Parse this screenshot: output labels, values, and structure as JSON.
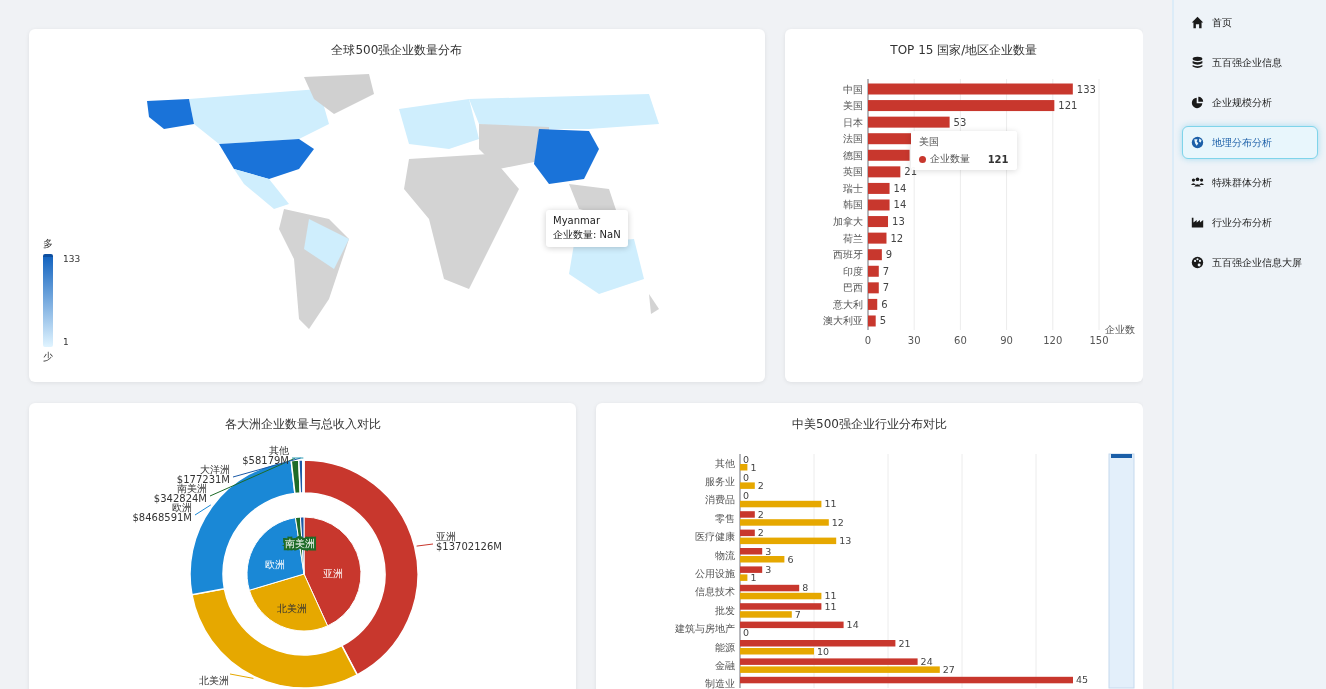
{
  "sidebar": {
    "items": [
      {
        "label": "首页",
        "selected": false
      },
      {
        "label": "五百强企业信息",
        "selected": false
      },
      {
        "label": "企业规模分析",
        "selected": false
      },
      {
        "label": "地理分布分析",
        "selected": true
      },
      {
        "label": "特殊群体分析",
        "selected": false
      },
      {
        "label": "行业分布分析",
        "selected": false
      },
      {
        "label": "五百强企业信息大屏",
        "selected": false
      }
    ]
  },
  "world_map": {
    "title": "全球500强企业数量分布",
    "visual_map": {
      "high_label": "多",
      "max": "133",
      "min": "1",
      "low_label": "少"
    },
    "tooltip": {
      "name": "Myanmar",
      "line": "企业数量: NaN"
    }
  },
  "top_countries": {
    "title": "TOP 15 国家/地区企业数量",
    "chart_data": {
      "type": "bar",
      "orientation": "horizontal",
      "xlabel": "企业数",
      "grid": true,
      "categories": [
        "中国",
        "美国",
        "日本",
        "法国",
        "德国",
        "英国",
        "瑞士",
        "韩国",
        "加拿大",
        "荷兰",
        "西班牙",
        "印度",
        "巴西",
        "意大利",
        "澳大利亚"
      ],
      "series": [
        {
          "color": "#c8372d",
          "values": [
            133,
            121,
            53,
            28,
            27,
            21,
            14,
            14,
            13,
            12,
            9,
            7,
            7,
            6,
            5
          ]
        }
      ],
      "value_labels": [
        "133",
        "121",
        "53",
        null,
        null,
        "21",
        "14",
        "14",
        "13",
        "12",
        "9",
        "7",
        "7",
        "6",
        "5"
      ],
      "xlim": [
        0,
        150
      ],
      "xticks": [
        0,
        30,
        60,
        90,
        120,
        150
      ]
    },
    "tooltip": {
      "category": "美国",
      "label": "企业数量",
      "value": "121"
    }
  },
  "continents": {
    "title": "各大洲企业数量与总收入对比",
    "chart_data": {
      "type": "donut",
      "categories": [
        "亚洲",
        "北美洲",
        "欧洲",
        "南美洲",
        "大洋洲",
        "其他"
      ],
      "colors": [
        "#c8372d",
        "#e6a800",
        "#1a88d6",
        "#1e6b28",
        "#1c5aa6",
        "#2a9db5"
      ],
      "series": [
        {
          "values": [
            42.27,
            29.82,
            26.12,
            1.06,
            0.55,
            0.18
          ]
        },
        {
          "values": [
            43.2,
            27.2,
            27.2,
            1.4,
            1.0,
            0
          ]
        }
      ],
      "value_labels": [
        "$13702126M",
        null,
        "$8468591M",
        "$342824M",
        "$177231M",
        "$58179M"
      ]
    },
    "inner_labels": [
      "亚洲",
      "北美洲",
      "欧洲",
      "南美洲"
    ]
  },
  "industry": {
    "title": "中美500强企业行业分布对比",
    "chart_data": {
      "type": "bar",
      "orientation": "horizontal",
      "grid": true,
      "categories": [
        "其他",
        "服务业",
        "消费品",
        "零售",
        "医疗健康",
        "物流",
        "公用设施",
        "信息技术",
        "批发",
        "建筑与房地产",
        "能源",
        "金融",
        "制造业"
      ],
      "series": [
        {
          "color": "#c8372d",
          "values": [
            0,
            0,
            0,
            2,
            2,
            3,
            3,
            8,
            11,
            14,
            21,
            24,
            45
          ]
        },
        {
          "color": "#e6a800",
          "values": [
            1,
            2,
            11,
            12,
            13,
            6,
            1,
            11,
            7,
            0,
            10,
            27,
            null
          ]
        }
      ],
      "data_labels": true
    }
  }
}
